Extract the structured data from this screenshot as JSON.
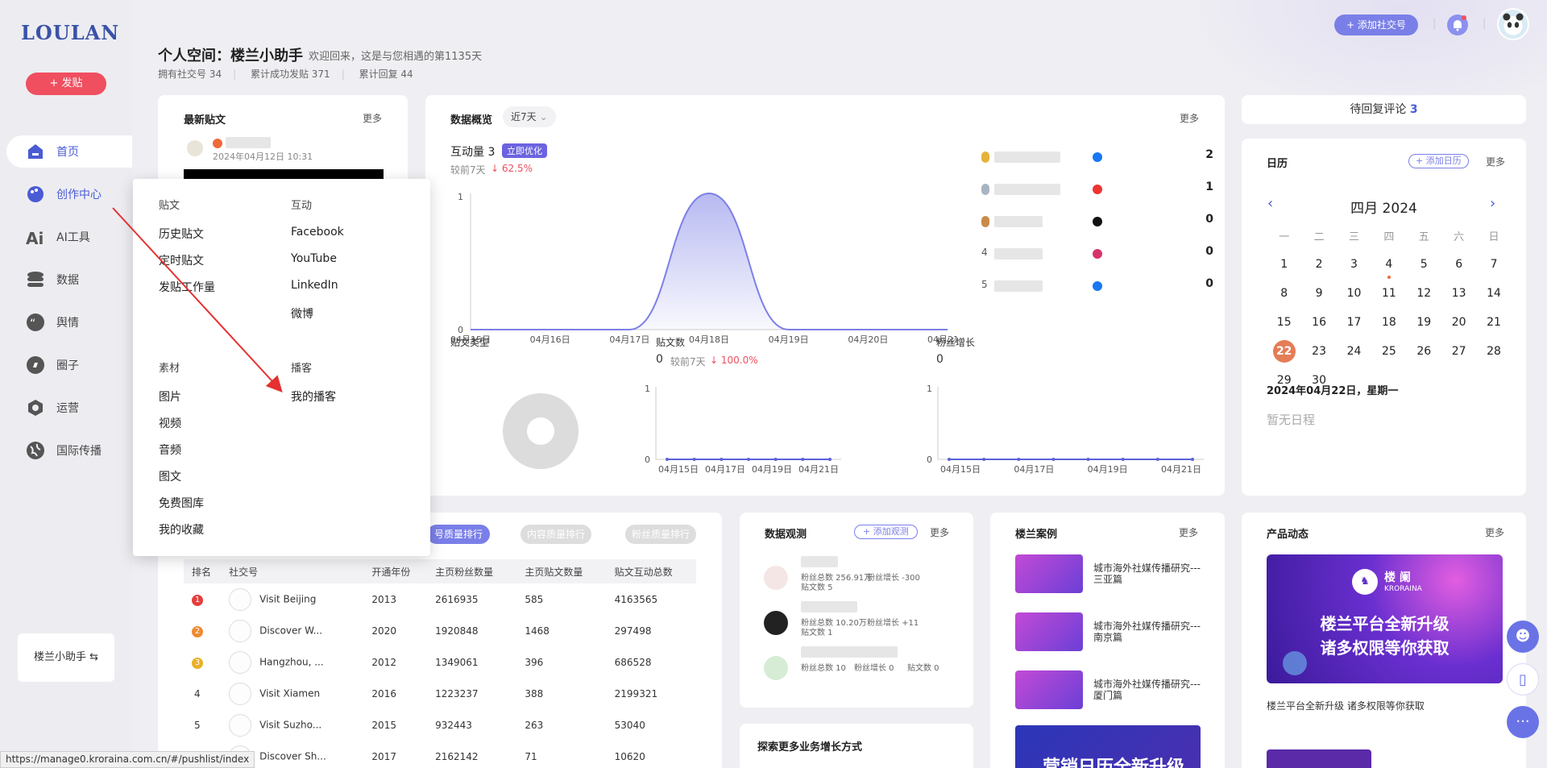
{
  "brand": {
    "logo": "LOULAN",
    "post_button": "+ 发贴"
  },
  "nav": [
    {
      "label": "首页",
      "icon": "home-icon"
    },
    {
      "label": "创作中心",
      "icon": "palette-icon"
    },
    {
      "label": "AI工具",
      "icon": "ai-icon"
    },
    {
      "label": "数据",
      "icon": "database-icon"
    },
    {
      "label": "舆情",
      "icon": "quote-icon"
    },
    {
      "label": "圈子",
      "icon": "compass-icon"
    },
    {
      "label": "运营",
      "icon": "operation-icon"
    },
    {
      "label": "国际传播",
      "icon": "globe-icon"
    }
  ],
  "helper": "楼兰小助手 ⇆",
  "status_url": "https://manage0.kroraina.com.cn/#/pushlist/index",
  "header": {
    "title": "个人空间：楼兰小助手",
    "welcome": "欢迎回来，这是与您相遇的第1135天",
    "stats": [
      "拥有社交号 34",
      "累计成功发贴 371",
      "累计回复 44"
    ],
    "add_social": "+ 添加社交号"
  },
  "latest_posts": {
    "title": "最新贴文",
    "more": "更多",
    "time": "2024年04月12日 10:31"
  },
  "overview": {
    "title": "数据概览",
    "range": "近7天",
    "more": "更多",
    "interact_label": "互动量 3",
    "optimize": "立即优化",
    "compare_label": "较前7天",
    "compare_value": "↓ 62.5%",
    "rank": [
      {
        "no": "",
        "platform": "facebook-icon",
        "value": "2"
      },
      {
        "no": "",
        "platform": "youtube-icon",
        "value": "1"
      },
      {
        "no": "",
        "platform": "x-icon",
        "value": "0"
      },
      {
        "no": "4",
        "platform": "instagram-icon",
        "value": "0"
      },
      {
        "no": "5",
        "platform": "facebook-icon",
        "value": "0"
      }
    ],
    "post_type_label": "贴文类型",
    "post_count_label": "贴文数",
    "post_count_value": "0",
    "post_count_compare": "较前7天",
    "post_count_change": "↓ 100.0%",
    "fans_label": "粉丝增长",
    "fans_value": "0"
  },
  "chart_data": [
    {
      "type": "area",
      "title": "互动量",
      "x": [
        "04月15日",
        "04月16日",
        "04月17日",
        "04月18日",
        "04月19日",
        "04月20日",
        "04月21日"
      ],
      "values": [
        0,
        0,
        0,
        1,
        0,
        0,
        0
      ],
      "ylim": [
        0,
        1
      ]
    },
    {
      "type": "line",
      "title": "贴文数",
      "x": [
        "04月15日",
        "04月17日",
        "04月19日",
        "04月21日"
      ],
      "values": [
        0,
        0,
        0,
        0,
        0,
        0,
        0
      ],
      "ylim": [
        0,
        1
      ]
    },
    {
      "type": "line",
      "title": "粉丝增长",
      "x": [
        "04月15日",
        "04月17日",
        "04月19日",
        "04月21日"
      ],
      "values": [
        0,
        0,
        0,
        0,
        0,
        0,
        0,
        0
      ],
      "ylim": [
        0,
        1
      ]
    }
  ],
  "menu": {
    "col1_head": "贴文",
    "col1": [
      "历史贴文",
      "定时贴文",
      "发贴工作量"
    ],
    "col2_head": "互动",
    "col2": [
      "Facebook",
      "YouTube",
      "LinkedIn",
      "微博"
    ],
    "col3_head": "素材",
    "col3": [
      "图片",
      "视频",
      "音频",
      "图文",
      "免费图库",
      "我的收藏"
    ],
    "col4_head": "播客",
    "col4": [
      "我的播客"
    ]
  },
  "ranking": {
    "tabs": [
      "号质量排行",
      "内容质量排行",
      "粉丝质量排行"
    ],
    "headers": [
      "排名",
      "社交号",
      "开通年份",
      "主页粉丝数量",
      "主页贴文数量",
      "贴文互动总数"
    ],
    "rows": [
      [
        "1",
        "Visit Beijing",
        "2013",
        "2616935",
        "585",
        "4163565"
      ],
      [
        "2",
        "Discover W...",
        "2020",
        "1920848",
        "1468",
        "297498"
      ],
      [
        "3",
        "Hangzhou, ...",
        "2012",
        "1349061",
        "396",
        "686528"
      ],
      [
        "4",
        "Visit Xiamen",
        "2016",
        "1223237",
        "388",
        "2199321"
      ],
      [
        "5",
        "Visit Suzho...",
        "2015",
        "932443",
        "263",
        "53040"
      ],
      [
        "",
        "Discover Sh...",
        "2017",
        "2162142",
        "71",
        "10620"
      ]
    ]
  },
  "observe": {
    "title": "数据观测",
    "add": "+ 添加观测",
    "more": "更多",
    "items": [
      {
        "line1": "粉丝总数 256.91万",
        "line1b": "粉丝增长 -300",
        "line2": "贴文数 5"
      },
      {
        "line1": "粉丝总数 10.20万",
        "line1b": "粉丝增长 +11",
        "line2": "贴文数 1"
      },
      {
        "line1": "粉丝总数 10",
        "line1b": "粉丝增长 0",
        "line2": "贴文数 0"
      }
    ],
    "explore": "探索更多业务增长方式"
  },
  "cases": {
    "title": "楼兰案例",
    "more": "更多",
    "items": [
      "城市海外社媒传播研究---三亚篇",
      "城市海外社媒传播研究---南京篇",
      "城市海外社媒传播研究---厦门篇"
    ],
    "banner": "营销日历全新升级"
  },
  "pending": {
    "label": "待回复评论",
    "count": "3"
  },
  "calendar": {
    "title": "日历",
    "add": "+ 添加日历",
    "more": "更多",
    "month": "四月 2024",
    "weekdays": [
      "一",
      "二",
      "三",
      "四",
      "五",
      "六",
      "日"
    ],
    "weeks": [
      [
        "1",
        "2",
        "3",
        "4",
        "5",
        "6",
        "7"
      ],
      [
        "8",
        "9",
        "10",
        "11",
        "12",
        "13",
        "14"
      ],
      [
        "15",
        "16",
        "17",
        "18",
        "19",
        "20",
        "21"
      ],
      [
        "22",
        "23",
        "24",
        "25",
        "26",
        "27",
        "28"
      ],
      [
        "29",
        "30",
        "",
        "",
        "",
        "",
        ""
      ]
    ],
    "selected": "2024年04月22日，星期一",
    "empty": "暂无日程"
  },
  "product": {
    "title": "产品动态",
    "more": "更多",
    "banner_brand": "楼 阑",
    "banner_brand_en": "KRORAINA",
    "banner_line1": "楼兰平台全新升级",
    "banner_line2": "诸多权限等你获取",
    "caption": "楼兰平台全新升级 诸多权限等你获取"
  },
  "colors": {
    "accent": "#4a5bd4",
    "red": "#ef4f5f",
    "chart": "#7c80e6",
    "today": "#e57d56"
  }
}
